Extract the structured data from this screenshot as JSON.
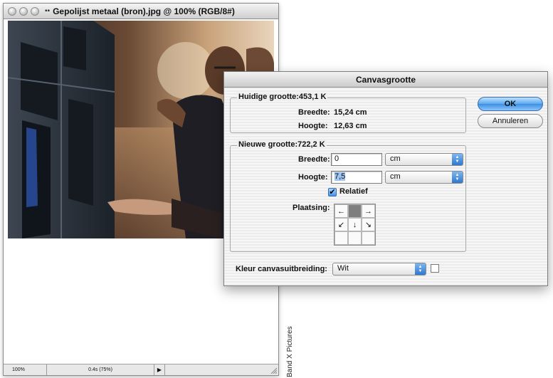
{
  "document": {
    "title": "Gepolijst metaal (bron).jpg @ 100% (RGB/8#)",
    "zoom": "100%",
    "info": "0.4s (75%)"
  },
  "credit": "Band X Pictures",
  "dialog": {
    "title": "Canvasgrootte",
    "current": {
      "label": "Huidige grootte:453,1 K",
      "width_label": "Breedte:",
      "width_value": "15,24 cm",
      "height_label": "Hoogte:",
      "height_value": "12,63 cm"
    },
    "new": {
      "label": "Nieuwe grootte:722,2 K",
      "width_label": "Breedte:",
      "width_value": "0",
      "width_unit": "cm",
      "height_label": "Hoogte:",
      "height_value": "7,5",
      "height_unit": "cm",
      "relative_label": "Relatief",
      "relative_checked": true,
      "anchor_label": "Plaatsing:"
    },
    "extension_color_label": "Kleur canvasuitbreiding:",
    "extension_color_value": "Wit",
    "extension_swatch_color": "#ffffff",
    "ok_label": "OK",
    "cancel_label": "Annuleren"
  }
}
